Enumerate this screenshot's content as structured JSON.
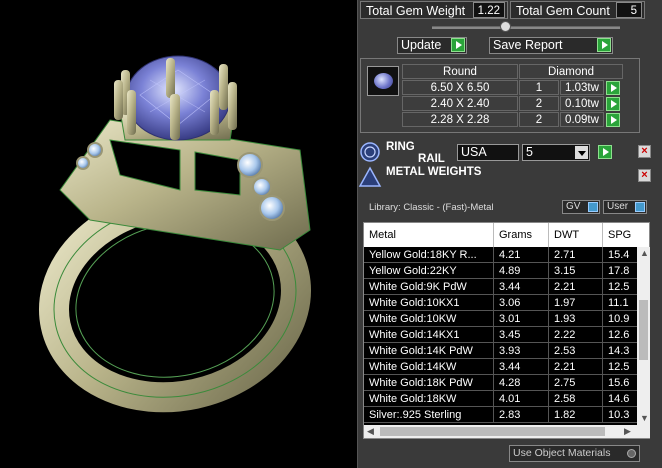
{
  "header": {
    "total_gem_weight_label": "Total Gem Weight",
    "total_gem_weight_value": "1.22",
    "total_gem_count_label": "Total Gem Count",
    "total_gem_count_value": "5"
  },
  "actions": {
    "update_label": "Update",
    "save_report_label": "Save Report"
  },
  "gems": {
    "col_shape": "Round",
    "col_type": "Diamond",
    "rows": [
      {
        "size": "6.50 X 6.50",
        "qty": "1",
        "weight": "1.03tw"
      },
      {
        "size": "2.40 X 2.40",
        "qty": "2",
        "weight": "0.10tw"
      },
      {
        "size": "2.28 X 2.28",
        "qty": "2",
        "weight": "0.09tw"
      }
    ]
  },
  "ring_rail": {
    "title_top": "RING",
    "title_bottom": "RAIL",
    "standard": "USA",
    "size": "5"
  },
  "metal_weights": {
    "title": "METAL WEIGHTS",
    "library": "Library: Classic - (Fast)-Metal",
    "toggle_gv": "GV",
    "toggle_user": "User",
    "columns": [
      "Metal",
      "Grams",
      "DWT",
      "SPG"
    ],
    "rows": [
      [
        "Yellow Gold:18KY R...",
        "4.21",
        "2.71",
        "15.4"
      ],
      [
        "Yellow Gold:22KY",
        "4.89",
        "3.15",
        "17.8"
      ],
      [
        "White Gold:9K PdW",
        "3.44",
        "2.21",
        "12.5"
      ],
      [
        "White Gold:10KX1",
        "3.06",
        "1.97",
        "11.1"
      ],
      [
        "White Gold:10KW",
        "3.01",
        "1.93",
        "10.9"
      ],
      [
        "White Gold:14KX1",
        "3.45",
        "2.22",
        "12.6"
      ],
      [
        "White Gold:14K PdW",
        "3.93",
        "2.53",
        "14.3"
      ],
      [
        "White Gold:14KW",
        "3.44",
        "2.21",
        "12.5"
      ],
      [
        "White Gold:18K PdW",
        "4.28",
        "2.75",
        "15.6"
      ],
      [
        "White Gold:18KW",
        "4.01",
        "2.58",
        "14.6"
      ],
      [
        "Silver:.925 Sterling",
        "2.83",
        "1.82",
        "10.3"
      ]
    ],
    "use_object_materials": "Use Object Materials"
  },
  "colors": {
    "accent_green": "#2aa43a",
    "metal_gold": "#b9b48a",
    "gem_blue": "#6d74c9"
  }
}
